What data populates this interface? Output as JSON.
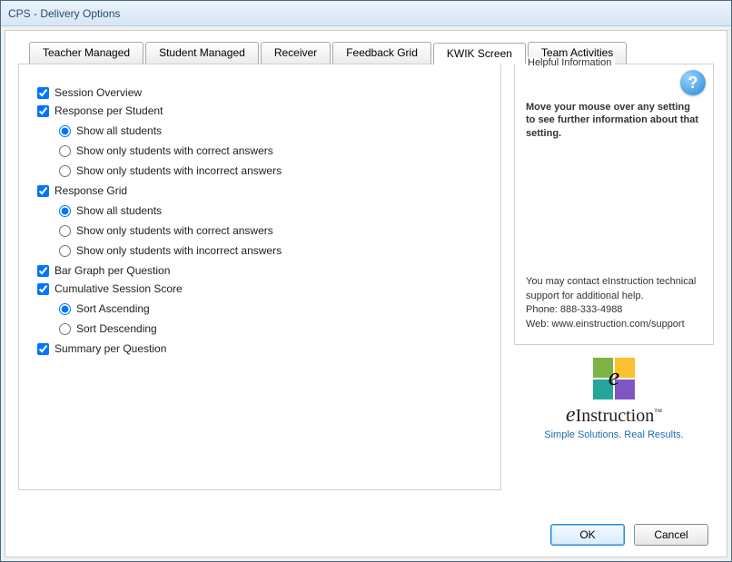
{
  "window": {
    "title": "CPS - Delivery Options"
  },
  "tabs": [
    {
      "label": "Teacher Managed",
      "active": false
    },
    {
      "label": "Student Managed",
      "active": false
    },
    {
      "label": "Receiver",
      "active": false
    },
    {
      "label": "Feedback Grid",
      "active": false
    },
    {
      "label": "KWIK Screen",
      "active": true
    },
    {
      "label": "Team Activities",
      "active": false
    }
  ],
  "settings": {
    "sessionOverview": {
      "label": "Session Overview",
      "checked": true
    },
    "responsePerStudent": {
      "label": "Response per Student",
      "checked": true,
      "options": [
        {
          "label": "Show all students",
          "selected": true
        },
        {
          "label": "Show only students with correct answers",
          "selected": false
        },
        {
          "label": "Show only students with incorrect answers",
          "selected": false
        }
      ]
    },
    "responseGrid": {
      "label": "Response Grid",
      "checked": true,
      "options": [
        {
          "label": "Show all students",
          "selected": true
        },
        {
          "label": "Show only students with correct answers",
          "selected": false
        },
        {
          "label": "Show only students with incorrect answers",
          "selected": false
        }
      ]
    },
    "barGraph": {
      "label": "Bar Graph per Question",
      "checked": true
    },
    "cumulative": {
      "label": "Cumulative Session Score",
      "checked": true,
      "options": [
        {
          "label": "Sort Ascending",
          "selected": true
        },
        {
          "label": "Sort Descending",
          "selected": false
        }
      ]
    },
    "summary": {
      "label": "Summary per Question",
      "checked": true
    }
  },
  "info": {
    "title": "Helpful Information",
    "hint": "Move your mouse over any setting to see further information about that setting.",
    "contact1": "You may contact eInstruction technical support for additional help.",
    "contact2": "Phone: 888-333-4988",
    "contact3": "Web: www.einstruction.com/support"
  },
  "logo": {
    "name": "eInstruction",
    "tagline": "Simple Solutions. Real Results."
  },
  "buttons": {
    "ok": "OK",
    "cancel": "Cancel"
  }
}
